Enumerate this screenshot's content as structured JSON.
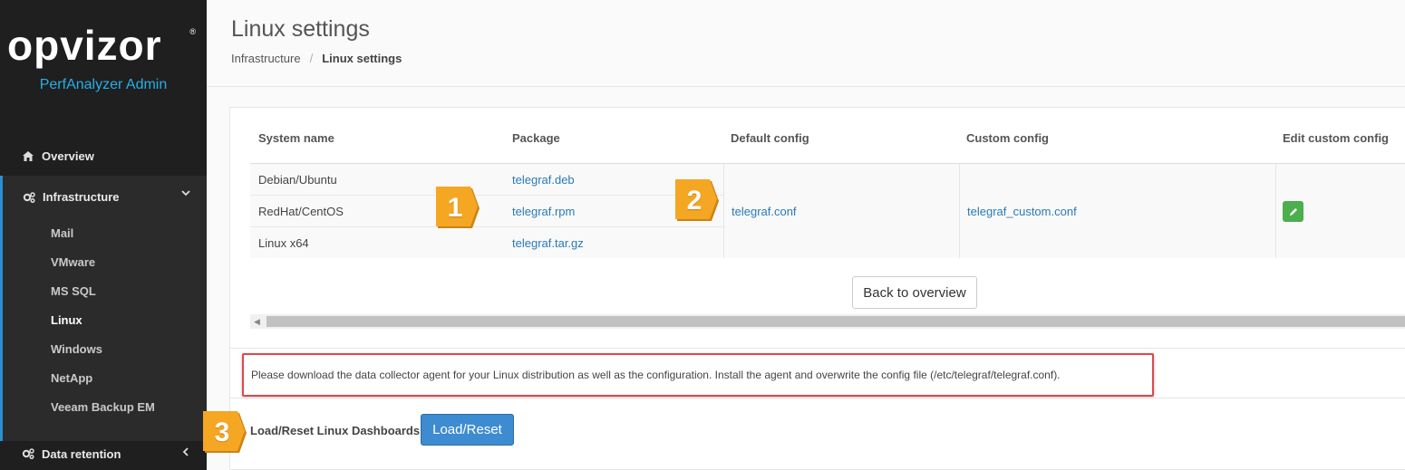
{
  "brand": {
    "logo_text": "opvizor",
    "reg_mark": "®",
    "subtitle": "PerfAnalyzer Admin"
  },
  "sidebar": {
    "overview": {
      "label": "Overview",
      "icon": "home-icon"
    },
    "infrastructure": {
      "label": "Infrastructure",
      "icon": "cogs-icon",
      "expanded": true,
      "items": [
        {
          "label": "Mail"
        },
        {
          "label": "VMware"
        },
        {
          "label": "MS SQL"
        },
        {
          "label": "Linux",
          "active": true
        },
        {
          "label": "Windows"
        },
        {
          "label": "NetApp"
        },
        {
          "label": "Veeam Backup EM"
        }
      ]
    },
    "data_retention": {
      "label": "Data retention",
      "icon": "cogs-icon"
    }
  },
  "header": {
    "title": "Linux settings",
    "breadcrumb": {
      "parent": "Infrastructure",
      "separator": "/",
      "current": "Linux settings"
    }
  },
  "table": {
    "headers": [
      "System name",
      "Package",
      "Default config",
      "Custom config",
      "Edit custom config"
    ],
    "rows": [
      {
        "system": "Debian/Ubuntu",
        "package": "telegraf.deb"
      },
      {
        "system": "RedHat/CentOS",
        "package": "telegraf.rpm"
      },
      {
        "system": "Linux x64",
        "package": "telegraf.tar.gz"
      }
    ],
    "default_config": "telegraf.conf",
    "custom_config": "telegraf_custom.conf"
  },
  "actions": {
    "back_label": "Back to overview",
    "load_reset_label": "Load/Reset Linux Dashboards",
    "load_reset_button": "Load/Reset"
  },
  "info_text": "Please download the data collector agent for your Linux distribution as well as the configuration. Install the agent and overwrite the config file (/etc/telegraf/telegraf.conf).",
  "callouts": [
    "1",
    "2",
    "3"
  ],
  "colors": {
    "sidebar_bg": "#1f1f1f",
    "accent": "#29aee6",
    "link": "#2a7ab9",
    "primary_button": "#3d8bd0",
    "edit_button": "#4cae4c",
    "highlight_border": "#e0474c",
    "callout": "#f5a623"
  }
}
